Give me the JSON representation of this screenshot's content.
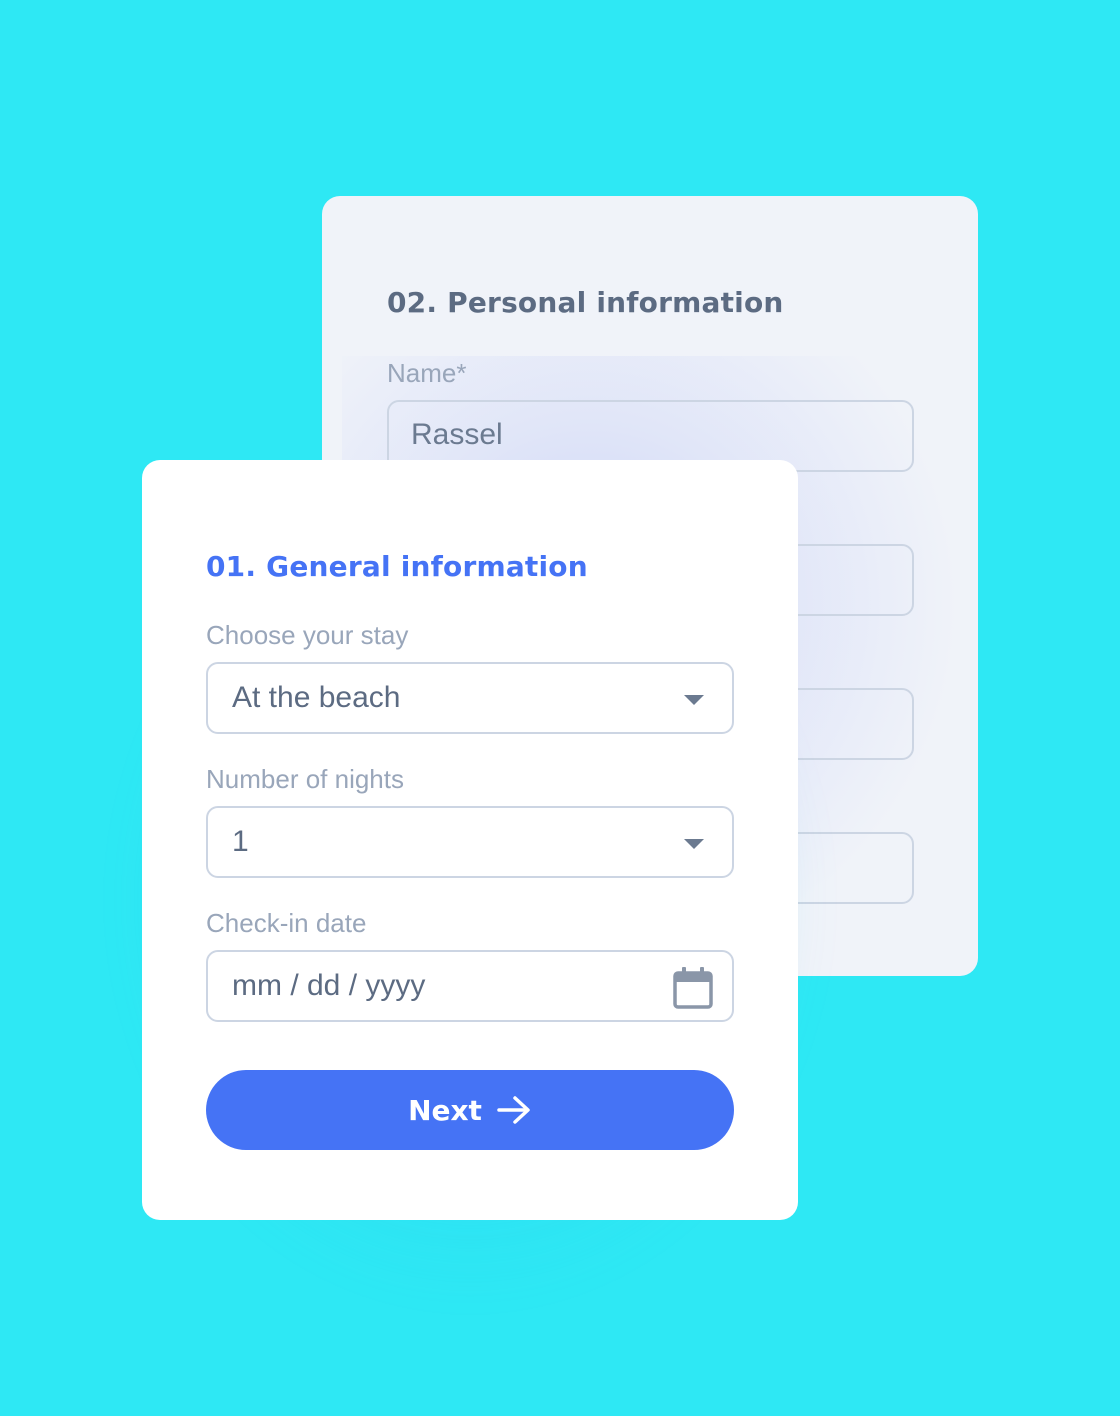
{
  "personal_card": {
    "title": "02. Personal information",
    "name_label": "Name*",
    "name_value": "Rassel"
  },
  "general_card": {
    "title": "01. General information",
    "stay_label": "Choose your stay",
    "stay_value": "At the beach",
    "nights_label": "Number of nights",
    "nights_value": "1",
    "checkin_label": "Check-in date",
    "checkin_placeholder": "mm / dd / yyyy",
    "next_label": "Next"
  },
  "icons": {
    "dropdown": "chevron-down-icon",
    "calendar": "calendar-icon",
    "next": "arrow-right-icon"
  },
  "colors": {
    "background": "#2EE8F4",
    "accent": "#4573F5",
    "text_muted": "#99A6BA",
    "text": "#5C6B82"
  }
}
